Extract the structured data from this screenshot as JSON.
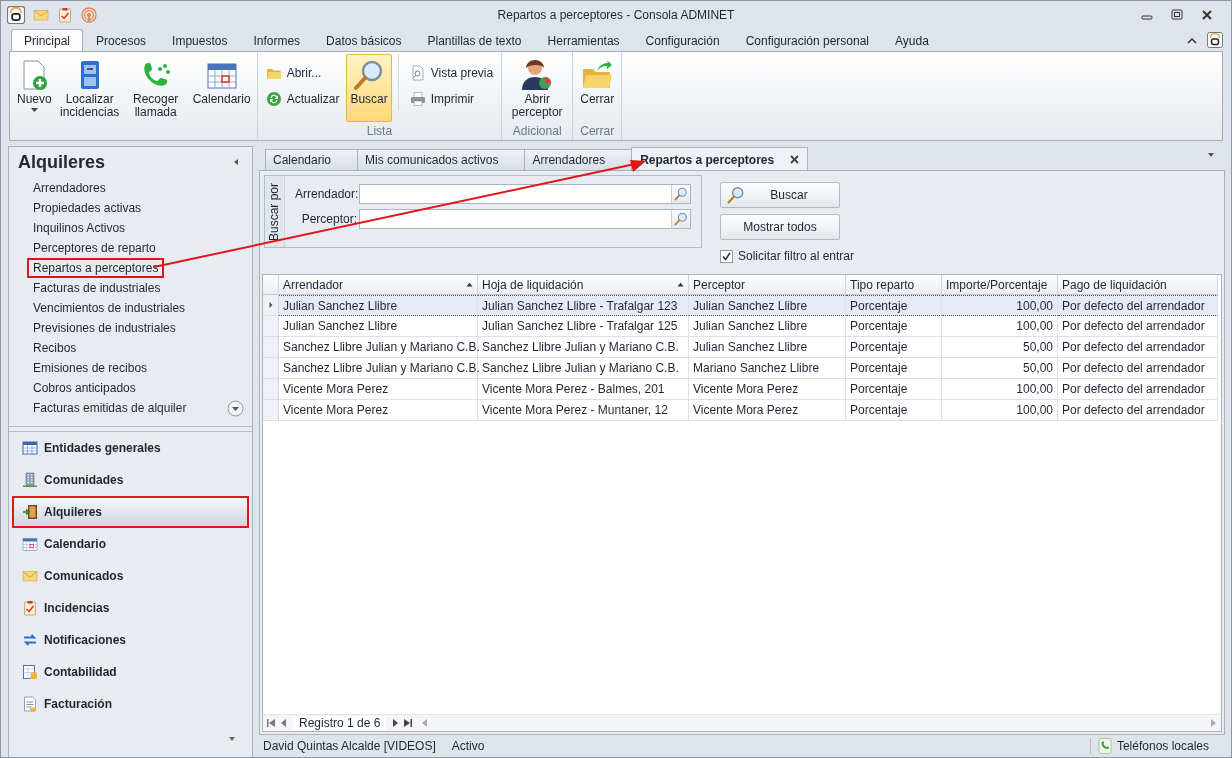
{
  "window": {
    "title": "Repartos a perceptores - Consola ADMINET"
  },
  "ribbon": {
    "tabs": [
      {
        "label": "Principal",
        "selected": true
      },
      {
        "label": "Procesos",
        "selected": false
      },
      {
        "label": "Impuestos",
        "selected": false
      },
      {
        "label": "Informes",
        "selected": false
      },
      {
        "label": "Datos básicos",
        "selected": false
      },
      {
        "label": "Plantillas de texto",
        "selected": false
      },
      {
        "label": "Herramientas",
        "selected": false
      },
      {
        "label": "Configuración",
        "selected": false
      },
      {
        "label": "Configuración personal",
        "selected": false
      },
      {
        "label": "Ayuda",
        "selected": false
      }
    ],
    "groups": [
      {
        "buttons": [
          {
            "label": "Nuevo",
            "kind": "large",
            "pressed": false,
            "dropdown": true
          },
          {
            "label": "Localizar incidencias",
            "kind": "large",
            "pressed": false
          },
          {
            "label": "Recoger llamada",
            "kind": "large",
            "pressed": false
          },
          {
            "label": "Calendario",
            "kind": "large",
            "pressed": false
          }
        ]
      },
      {
        "label": "Lista",
        "buttons": [
          {
            "label": "Abrir...",
            "kind": "small",
            "pressed": false
          },
          {
            "label": "Actualizar",
            "kind": "small",
            "pressed": false
          },
          {
            "label": "Buscar",
            "kind": "large",
            "pressed": true
          },
          {
            "label": "Vista previa",
            "kind": "small",
            "pressed": false
          },
          {
            "label": "Imprimir",
            "kind": "small",
            "pressed": false
          }
        ]
      },
      {
        "label": "Adicional",
        "buttons": [
          {
            "label": "Abrir perceptor",
            "kind": "large",
            "pressed": false
          }
        ]
      },
      {
        "label": "Cerrar",
        "buttons": [
          {
            "label": "Cerrar",
            "kind": "large",
            "pressed": false
          }
        ]
      }
    ]
  },
  "sidebar": {
    "title": "Alquileres",
    "items": [
      {
        "label": "Arrendadores",
        "highlighted": false
      },
      {
        "label": "Propiedades activas",
        "highlighted": false
      },
      {
        "label": "Inquilinos Activos",
        "highlighted": false
      },
      {
        "label": "Perceptores de reparto",
        "highlighted": false
      },
      {
        "label": "Repartos a perceptores",
        "highlighted": true
      },
      {
        "label": "Facturas de industriales",
        "highlighted": false
      },
      {
        "label": "Vencimientos de industriales",
        "highlighted": false
      },
      {
        "label": "Previsiones de industriales",
        "highlighted": false
      },
      {
        "label": "Recibos",
        "highlighted": false
      },
      {
        "label": "Emisiones de recibos",
        "highlighted": false
      },
      {
        "label": "Cobros anticipados",
        "highlighted": false
      },
      {
        "label": "Facturas emitidas de alquiler",
        "highlighted": false
      }
    ],
    "nav": [
      {
        "label": "Entidades generales",
        "selected": false,
        "highlighted": false
      },
      {
        "label": "Comunidades",
        "selected": false,
        "highlighted": false
      },
      {
        "label": "Alquileres",
        "selected": true,
        "highlighted": true
      },
      {
        "label": "Calendario",
        "selected": false,
        "highlighted": false
      },
      {
        "label": "Comunicados",
        "selected": false,
        "highlighted": false
      },
      {
        "label": "Incidencias",
        "selected": false,
        "highlighted": false
      },
      {
        "label": "Notificaciones",
        "selected": false,
        "highlighted": false
      },
      {
        "label": "Contabilidad",
        "selected": false,
        "highlighted": false
      },
      {
        "label": "Facturación",
        "selected": false,
        "highlighted": false
      }
    ]
  },
  "doc_tabs": [
    {
      "label": "Calendario",
      "selected": false
    },
    {
      "label": "Mis comunicados activos",
      "selected": false
    },
    {
      "label": "Arrendadores",
      "selected": false
    },
    {
      "label": "Repartos a perceptores",
      "selected": true,
      "closable": true
    }
  ],
  "filter": {
    "group_label": "Buscar por",
    "fields": [
      {
        "label": "Arrendador:"
      },
      {
        "label": "Perceptor:"
      }
    ],
    "buttons": [
      {
        "label": "Buscar",
        "kind": "search"
      },
      {
        "label": "Mostrar todos",
        "kind": "plain"
      }
    ],
    "checkbox": {
      "label": "Solicitar filtro al entrar",
      "checked": true
    }
  },
  "table": {
    "columns": [
      {
        "label": "Arrendador",
        "kind": "text",
        "sorted": true
      },
      {
        "label": "Hoja de liquidación",
        "kind": "text",
        "sorted": true
      },
      {
        "label": "Perceptor",
        "kind": "text",
        "sorted": false
      },
      {
        "label": "Tipo reparto",
        "kind": "text",
        "sorted": false
      },
      {
        "label": "Importe/Porcentaje",
        "kind": "number",
        "sorted": false
      },
      {
        "label": "Pago de liquidación",
        "kind": "text",
        "sorted": false
      }
    ],
    "rows": [
      {
        "selected": true,
        "cells": [
          "Julian Sanchez Llibre",
          "Julian Sanchez Llibre - Trafalgar 123",
          "Julian Sanchez Llibre",
          "Porcentaje",
          "100,00",
          "Por defecto del arrendador"
        ]
      },
      {
        "selected": false,
        "cells": [
          "Julian Sanchez Llibre",
          "Julian Sanchez Llibre - Trafalgar 125",
          "Julian Sanchez Llibre",
          "Porcentaje",
          "100,00",
          "Por defecto del arrendador"
        ]
      },
      {
        "selected": false,
        "cells": [
          "Sanchez Llibre Julian y Mariano C.B.",
          "Sanchez Llibre Julian y Mariano C.B.",
          "Julian Sanchez Llibre",
          "Porcentaje",
          "50,00",
          "Por defecto del arrendador"
        ]
      },
      {
        "selected": false,
        "cells": [
          "Sanchez Llibre Julian y Mariano C.B.",
          "Sanchez Llibre Julian y Mariano C.B.",
          "Mariano Sanchez Llibre",
          "Porcentaje",
          "50,00",
          "Por defecto del arrendador"
        ]
      },
      {
        "selected": false,
        "cells": [
          "Vicente Mora Perez",
          "Vicente Mora Perez - Balmes, 201",
          "Vicente Mora Perez",
          "Porcentaje",
          "100,00",
          "Por defecto del arrendador"
        ]
      },
      {
        "selected": false,
        "cells": [
          "Vicente Mora Perez",
          "Vicente Mora Perez - Muntaner, 12",
          "Vicente Mora Perez",
          "Porcentaje",
          "100,00",
          "Por defecto del arrendador"
        ]
      }
    ],
    "pager": "Registro 1 de 6"
  },
  "status_bar": {
    "user": "David Quintas Alcalde [VIDEOS]",
    "state": "Activo",
    "phones": "Teléfonos locales"
  },
  "annotation": {
    "arrow": true
  }
}
